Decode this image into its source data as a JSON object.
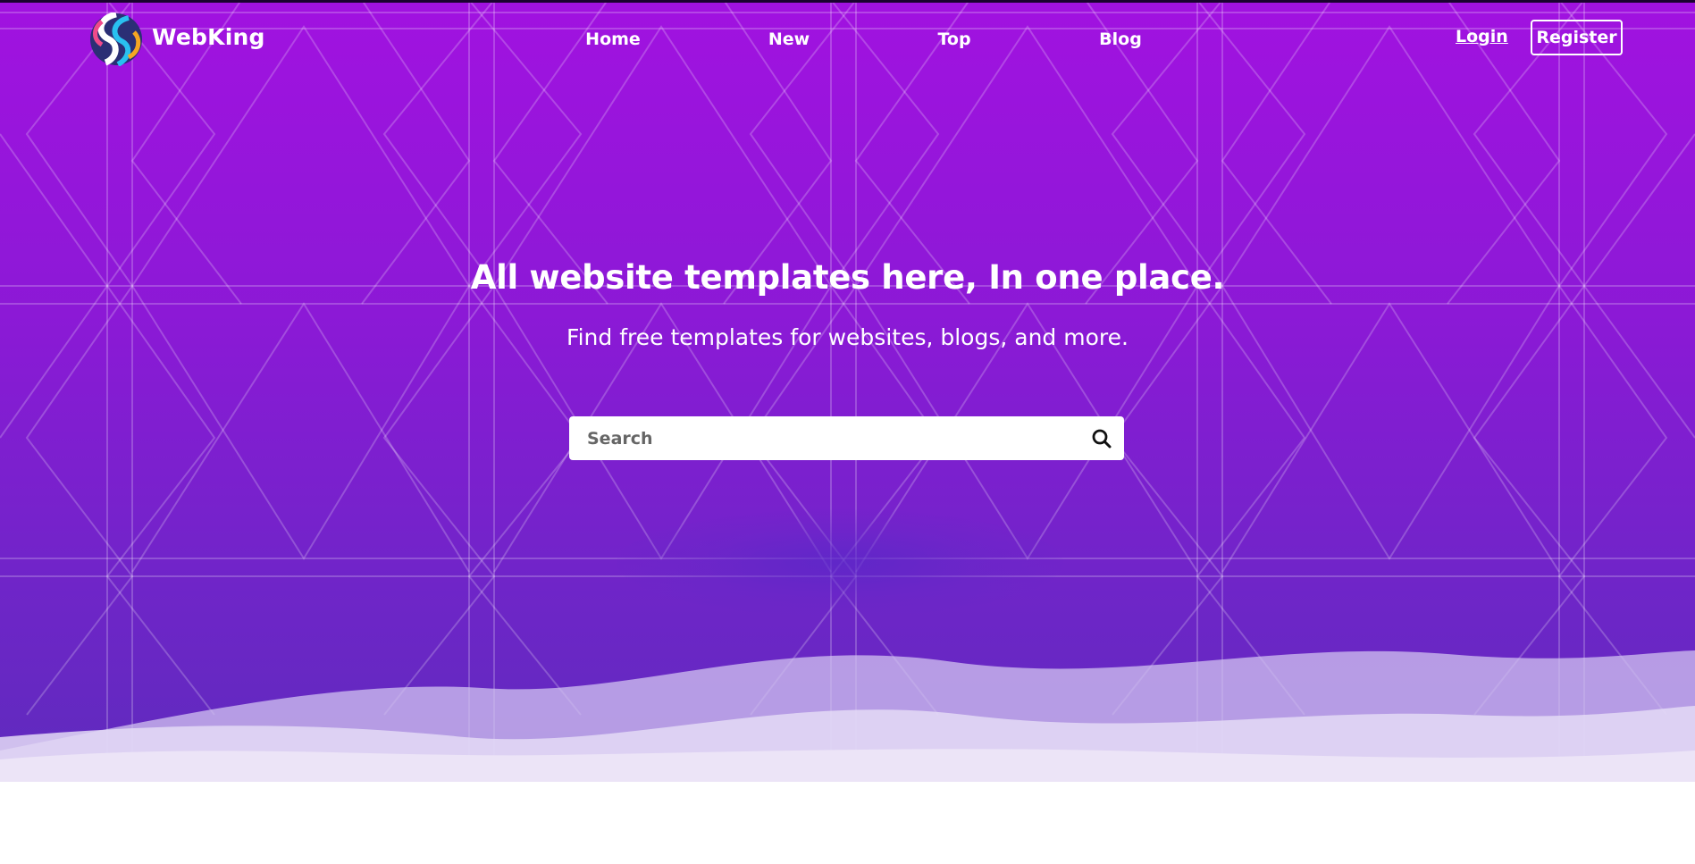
{
  "brand": {
    "name": "WebKing",
    "logo_icon": "swirl-logo-icon"
  },
  "nav": {
    "items": [
      {
        "label": "Home"
      },
      {
        "label": "New"
      },
      {
        "label": "Top"
      },
      {
        "label": "Blog"
      }
    ],
    "login_label": "Login",
    "register_label": "Register"
  },
  "hero": {
    "headline": "All website templates here, In one place.",
    "subheadline": "Find free templates for websites, blogs, and more.",
    "search": {
      "placeholder": "Search",
      "value": "",
      "icon": "search-icon"
    }
  },
  "colors": {
    "gradient_top": "#a112e0",
    "gradient_bottom": "#5e2bbd",
    "text": "#ffffff",
    "wave_light": "#ece4f7"
  }
}
